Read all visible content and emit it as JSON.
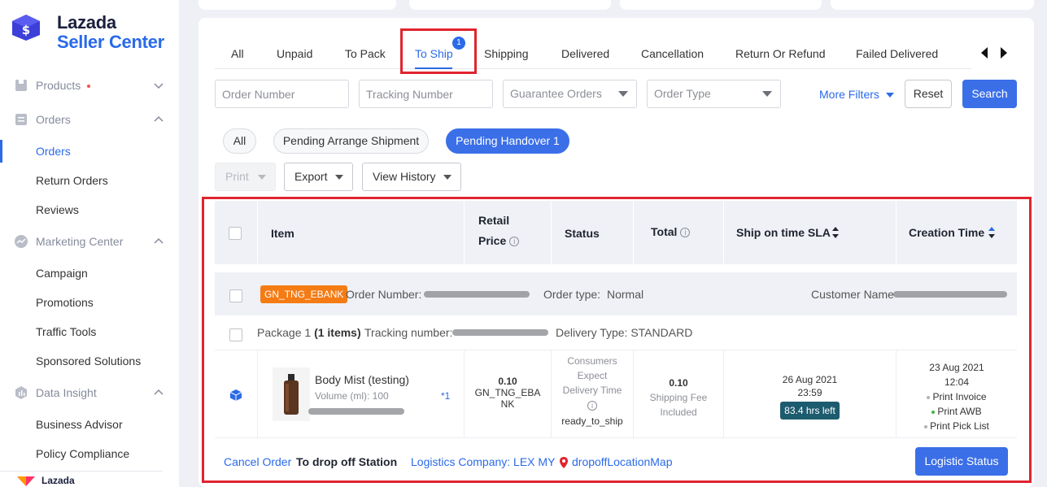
{
  "brand": {
    "line1": "Lazada",
    "line2": "Seller Center",
    "footer": "Lazada"
  },
  "sidebar": {
    "products": "Products",
    "orders": "Orders",
    "orders_items": [
      "Orders",
      "Return Orders",
      "Reviews"
    ],
    "marketing": "Marketing Center",
    "marketing_items": [
      "Campaign",
      "Promotions",
      "Traffic Tools",
      "Sponsored Solutions"
    ],
    "data": "Data Insight",
    "data_items": [
      "Business Advisor",
      "Policy Compliance"
    ]
  },
  "tabs": [
    "All",
    "Unpaid",
    "To Pack",
    "To Ship",
    "Shipping",
    "Delivered",
    "Cancellation",
    "Return Or Refund",
    "Failed Delivered"
  ],
  "tab_badge": "1",
  "filters": {
    "order_number": "Order Number",
    "tracking_number": "Tracking Number",
    "guarantee": "Guarantee Orders",
    "order_type": "Order Type",
    "more_filters": "More Filters",
    "reset": "Reset",
    "search": "Search"
  },
  "chips": [
    "All",
    "Pending Arrange Shipment",
    "Pending Handover 1"
  ],
  "actions": {
    "print": "Print",
    "export": "Export",
    "history": "View History"
  },
  "table": {
    "headers": {
      "item": "Item",
      "price_1": "Retail",
      "price_2": "Price",
      "status": "Status",
      "total": "Total",
      "sla": "Ship on time SLA",
      "creation": "Creation Time"
    },
    "order": {
      "tag": "GN_TNG_EBANK",
      "number_label": "Order Number:",
      "type_label": "Order type:",
      "type_value": "Normal",
      "customer_label": "Customer Name"
    },
    "package": {
      "label": "Package 1",
      "items": "(1 items)",
      "tracking_label": "Tracking number:",
      "delivery": "Delivery Type: STANDARD"
    },
    "item": {
      "name": "Body Mist (testing)",
      "variant": "Volume (ml): 100",
      "qty": "*1",
      "price": "0.10",
      "price_note_1": "GN_TNG_EBA",
      "price_note_2": "NK",
      "status_1": "Consumers",
      "status_2": "Expect",
      "status_3": "Delivery Time",
      "status_value": "ready_to_ship",
      "total": "0.10",
      "total_note_1": "Shipping Fee",
      "total_note_2": "Included",
      "sla_date": "26 Aug 2021",
      "sla_time": "23:59",
      "sla_left": "83.4 hrs left",
      "created_date": "23 Aug 2021",
      "created_time": "12:04",
      "print_invoice": "Print Invoice",
      "print_awb": "Print AWB",
      "print_pick": "Print Pick List"
    },
    "footer": {
      "cancel": "Cancel Order",
      "drop": "To drop off Station",
      "logistics": "Logistics Company: LEX MY",
      "location": "dropoffLocationMap",
      "status_btn": "Logistic Status"
    }
  },
  "colors": {
    "accent": "#2a6ae9",
    "highlight": "#e0242f",
    "tag": "#f57b14"
  }
}
